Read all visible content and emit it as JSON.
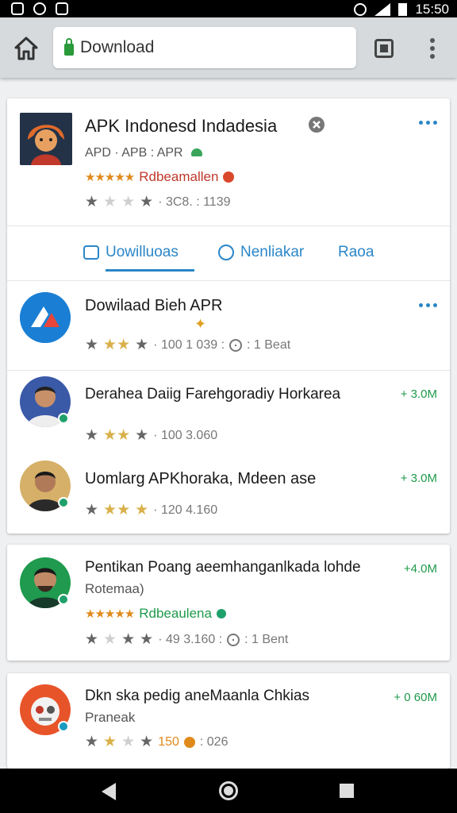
{
  "status": {
    "time": "15:50"
  },
  "browser": {
    "url_text": "Download"
  },
  "header_app": {
    "title": "APK Indonesd Indadesia",
    "subtitle": "APD · APB : APR",
    "rating_label": "Rdbeamallen",
    "stats": "· 3C8. : 1139"
  },
  "tabs": [
    {
      "label": "Uowilluoas",
      "icon": "download-icon"
    },
    {
      "label": "Nenliakar",
      "icon": "search-icon"
    },
    {
      "label": "Raoa",
      "icon": ""
    }
  ],
  "list1": [
    {
      "title": "Dowilaad Bieh APR",
      "stats": "· 100  1 039 :",
      "extra": ": 1 Beat"
    },
    {
      "title": "Derahea Daiig Farehgoradiy Horkarea",
      "stats": "· 100  3.060",
      "size": "+ 3.0M"
    },
    {
      "title": "Uomlarg APKhoraka, Mdeen ase",
      "stats": "· 120  4.160",
      "size": "+ 3.0M"
    }
  ],
  "card2": {
    "title": "Pentikan Poang aeemhanganlkada lohde",
    "subtitle": "Rotemaa)",
    "rating_label": "Rdbeaulena",
    "stats": "· 49  3.160 :",
    "extra": ": 1 Bent",
    "size": "+4.0M"
  },
  "card3": {
    "title": "Dkn ska pedig aneMaanla Chkias",
    "subtitle": "Praneak",
    "stats_num": "150",
    "stats": ": 026",
    "size": "+ 0 60M"
  },
  "colors": {
    "accent": "#2a86c8",
    "green": "#1e9a4a",
    "gold": "#e08a1c"
  }
}
